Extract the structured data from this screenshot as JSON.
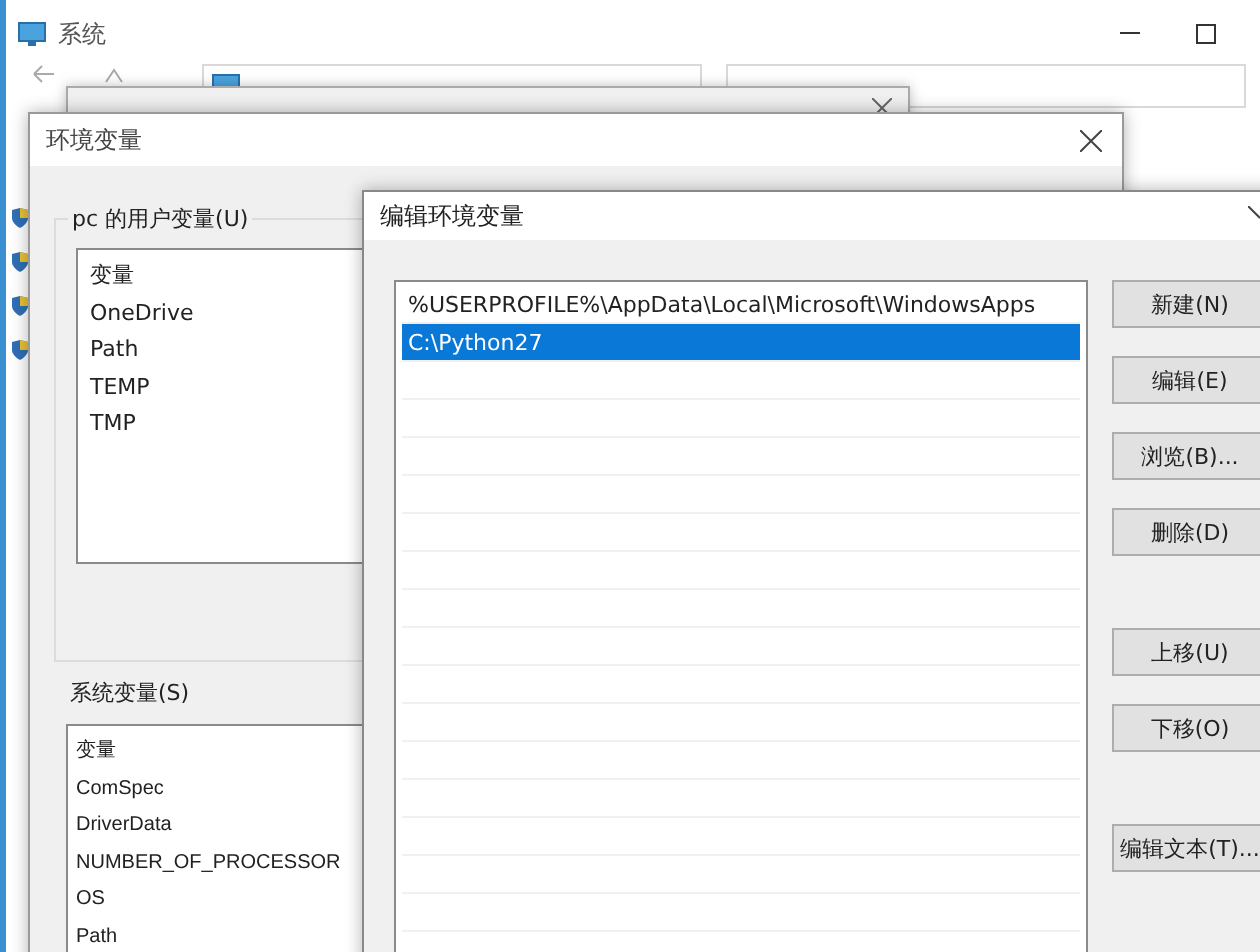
{
  "system_window": {
    "title": "系统"
  },
  "env_dialog": {
    "title": "环境变量",
    "user_vars": {
      "label": "pc 的用户变量(U)",
      "header": "变量",
      "rows": [
        {
          "name": "OneDrive"
        },
        {
          "name": "Path"
        },
        {
          "name": "TEMP"
        },
        {
          "name": "TMP"
        }
      ]
    },
    "system_vars": {
      "label": "系统变量(S)",
      "header": "变量",
      "rows": [
        {
          "name": "ComSpec"
        },
        {
          "name": "DriverData"
        },
        {
          "name": "NUMBER_OF_PROCESSOR"
        },
        {
          "name": "OS"
        },
        {
          "name": "Path"
        }
      ]
    }
  },
  "edit_dialog": {
    "title": "编辑环境变量",
    "entries": [
      {
        "text": "%USERPROFILE%\\AppData\\Local\\Microsoft\\WindowsApps",
        "selected": false
      },
      {
        "text": "C:\\Python27",
        "selected": true
      }
    ],
    "button_groups": [
      [
        "新建(N)",
        "编辑(E)",
        "浏览(B)...",
        "删除(D)"
      ],
      [
        "上移(U)",
        "下移(O)"
      ],
      [
        "编辑文本(T)..."
      ]
    ]
  }
}
